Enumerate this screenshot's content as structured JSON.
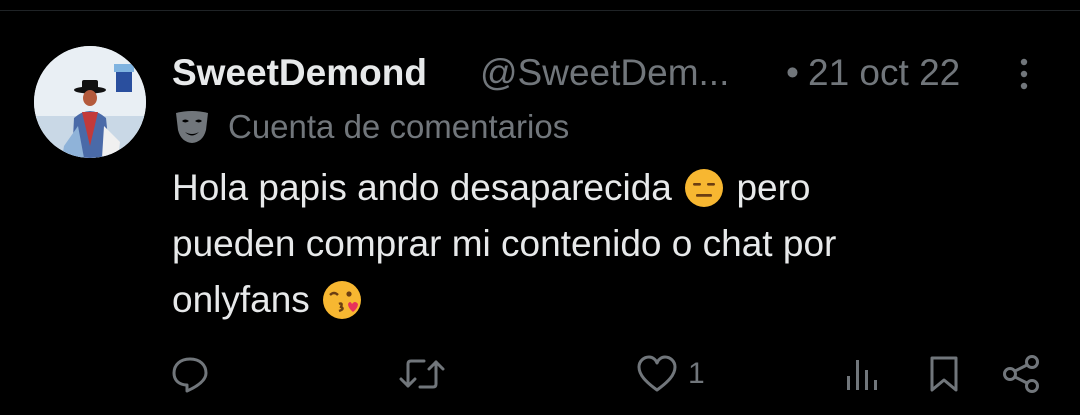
{
  "tweet": {
    "display_name": "SweetDemond",
    "handle": "@SweetDem...",
    "separator": "•",
    "date": "21 oct 22",
    "account_label": "Cuenta de comentarios",
    "text_line1": "Hola papis ando desaparecida",
    "text_line1b": "pero",
    "text_line2": "pueden comprar mi contenido o chat por",
    "text_line3": "onlyfans",
    "emojis": [
      "expressionless-face",
      "face-blowing-kiss"
    ]
  },
  "actions": {
    "reply_count": "",
    "retweet_count": "",
    "like_count": "1",
    "icons": [
      "reply-icon",
      "retweet-icon",
      "like-icon",
      "views-icon",
      "bookmark-icon",
      "share-icon"
    ]
  },
  "colors": {
    "background": "#000000",
    "primary_text": "#e7e9ea",
    "secondary_text": "#71767b",
    "emoji_yellow": "#f7b731"
  }
}
